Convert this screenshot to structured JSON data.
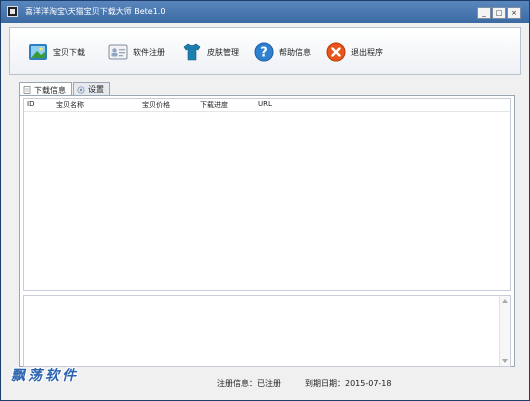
{
  "window": {
    "title": "喜洋洋淘宝\\天猫宝贝下载大师 Bete1.0"
  },
  "window_controls": {
    "minimize": "_",
    "maximize": "□",
    "close": "×"
  },
  "toolbar": {
    "items": [
      {
        "label": "宝贝下载",
        "icon": "image-download-icon"
      },
      {
        "label": "软件注册",
        "icon": "id-card-icon"
      },
      {
        "label": "皮肤管理",
        "icon": "tshirt-icon"
      },
      {
        "label": "帮助信息",
        "icon": "help-icon"
      },
      {
        "label": "退出程序",
        "icon": "exit-icon"
      }
    ]
  },
  "tabs": [
    {
      "label": "下载信息",
      "active": true,
      "icon": "document-icon"
    },
    {
      "label": "设置",
      "active": false,
      "icon": "settings-icon"
    }
  ],
  "table": {
    "columns": [
      "ID",
      "宝贝名称",
      "宝贝价格",
      "下载进度",
      "URL"
    ],
    "rows": []
  },
  "status": {
    "registration": "注册信息：已注册",
    "expiry": "到期日期：2015-07-18"
  },
  "watermark": "飘荡软件",
  "colors": {
    "titlebar": "#3b6aa3",
    "accent_blue": "#2f80d0",
    "exit_orange": "#e8541a",
    "shirt_teal": "#1c7fae"
  }
}
